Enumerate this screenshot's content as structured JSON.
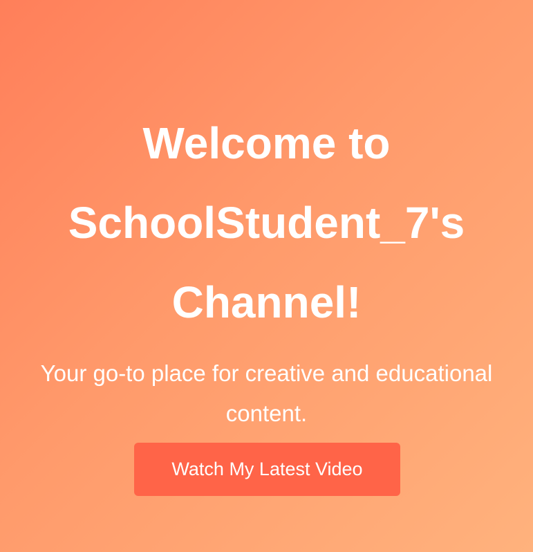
{
  "hero": {
    "title": "Welcome to SchoolStudent_7's Channel!",
    "subtitle": "Your go-to place for creative and educational content.",
    "cta_label": "Watch My Latest Video"
  },
  "colors": {
    "gradient_start": "#ff7f5a",
    "gradient_end": "#ffb27d",
    "button_bg": "#ff6448",
    "text": "#ffffff"
  }
}
